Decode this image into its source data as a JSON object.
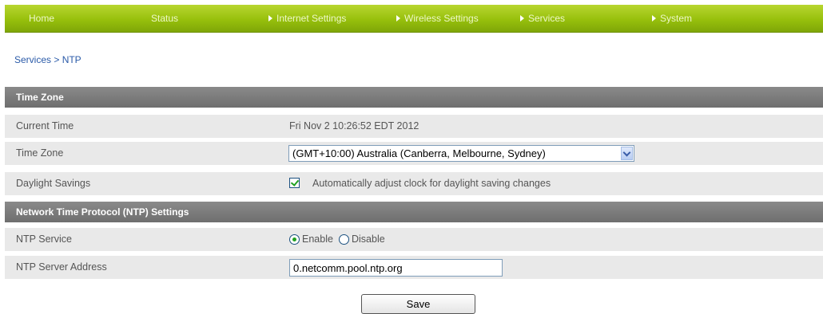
{
  "nav": {
    "items": [
      {
        "label": "Home"
      },
      {
        "label": "Status"
      },
      {
        "label": "Internet Settings"
      },
      {
        "label": "Wireless Settings"
      },
      {
        "label": "Services"
      },
      {
        "label": "System"
      }
    ]
  },
  "breadcrumb": "Services > NTP",
  "time_zone_section": {
    "title": "Time Zone",
    "current_time_label": "Current Time",
    "current_time_value": "Fri Nov 2 10:26:52 EDT 2012",
    "time_zone_label": "Time Zone",
    "time_zone_selected": "(GMT+10:00) Australia (Canberra, Melbourne, Sydney)",
    "daylight_label": "Daylight Savings",
    "daylight_checked": true,
    "daylight_text": "Automatically adjust clock for daylight saving changes"
  },
  "ntp_section": {
    "title": "Network Time Protocol (NTP) Settings",
    "service_label": "NTP Service",
    "enable_label": "Enable",
    "disable_label": "Disable",
    "selected": "Enable",
    "server_label": "NTP Server Address",
    "server_value": "0.netcomm.pool.ntp.org"
  },
  "save_label": "Save",
  "colors": {
    "nav_green": "#97c00c",
    "section_gray": "#7a7a7a",
    "row_gray": "#e9e9e9",
    "link_blue": "#2a5aa8",
    "check_green": "#21a121"
  }
}
